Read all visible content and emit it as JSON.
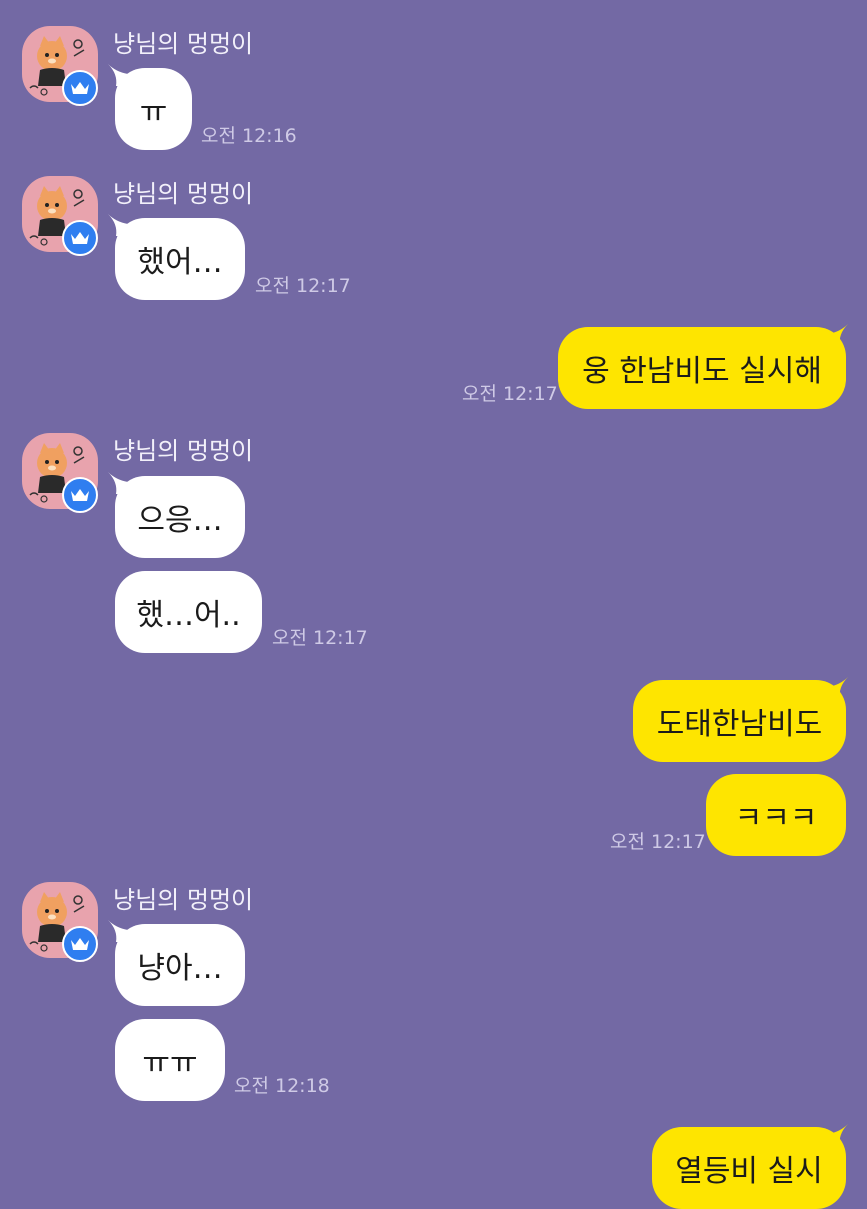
{
  "chat": {
    "sender_name": "냥님의 멍멍이",
    "messages": [
      {
        "from": "them",
        "text": "ㅠ",
        "time": "오전 12:16"
      },
      {
        "from": "them",
        "text": "했어…",
        "time": "오전 12:17"
      },
      {
        "from": "me",
        "text": "웅 한남비도 실시해",
        "time": "오전 12:17"
      },
      {
        "from": "them",
        "text": "으응…",
        "time": ""
      },
      {
        "from": "them",
        "text": "했…어..",
        "time": "오전 12:17"
      },
      {
        "from": "me",
        "text": "도태한남비도",
        "time": ""
      },
      {
        "from": "me",
        "text": "ㅋㅋㅋ",
        "time": "오전 12:17"
      },
      {
        "from": "them",
        "text": "냥아…",
        "time": ""
      },
      {
        "from": "them",
        "text": "ㅠㅠ",
        "time": "오전 12:18"
      },
      {
        "from": "me",
        "text": "열등비 실시",
        "time": ""
      }
    ]
  },
  "colors": {
    "background": "#7369a4",
    "incoming_bubble": "#ffffff",
    "outgoing_bubble": "#fee500",
    "badge": "#2f7ef0"
  },
  "icons": {
    "avatar": "dog-character-avatar",
    "badge": "crown-icon"
  }
}
